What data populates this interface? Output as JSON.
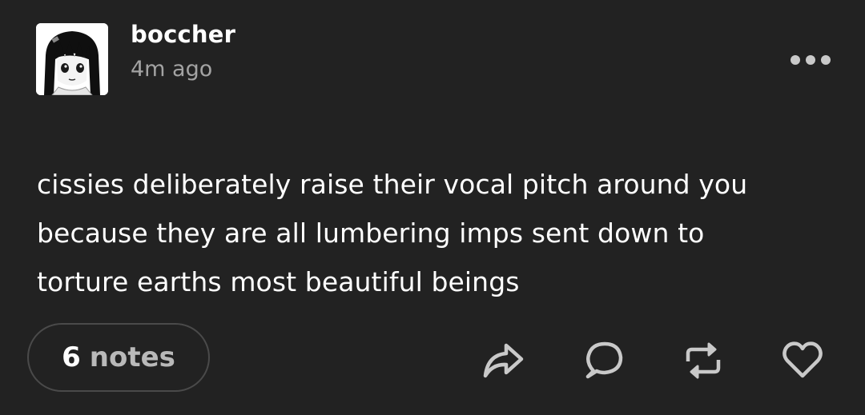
{
  "post": {
    "username": "boccher",
    "timestamp": "4m ago",
    "text_lines": [
      "cissies deliberately raise their vocal pitch around you",
      "because they are all lumbering imps sent down to",
      "torture earths most beautiful beings"
    ]
  },
  "notes": {
    "count": "6",
    "label": "notes"
  },
  "icons": {
    "more": "more-options-icon",
    "share": "share-icon",
    "reply": "reply-icon",
    "reblog": "reblog-icon",
    "like": "heart-icon"
  },
  "colors": {
    "background": "#222222",
    "text": "#ffffff",
    "muted": "#a3a3a3",
    "border": "#4a4a4a",
    "icon": "#c9c9c9"
  }
}
